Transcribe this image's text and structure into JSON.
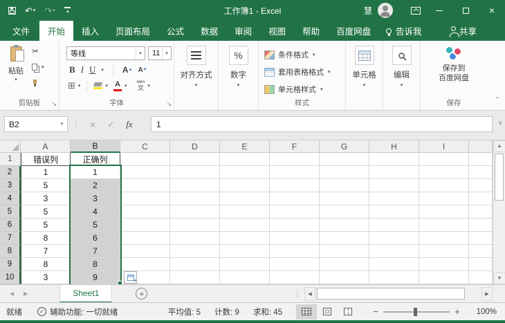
{
  "colors": {
    "excel_green": "#217346",
    "selection_fill": "#d2d2d2",
    "fill_color_swatch": "#ffe51f",
    "font_color_swatch": "#e00c0c",
    "baidu_teal": "#2fb8b4",
    "baidu_blue": "#3f87d6",
    "baidu_red": "#e14a68"
  },
  "glyphs": {
    "dropdown": "▾",
    "undo": "↶",
    "redo": "↷",
    "launcher": "↘",
    "expand": "˅",
    "collapse": "ˆ",
    "more_dots": "⋮",
    "scissors": "✂",
    "up": "▲",
    "down": "▼",
    "left": "◀",
    "right": "▶",
    "grow_caret": "▲",
    "shrink_caret": "▼",
    "close": "×",
    "percent": "%"
  },
  "titlebar": {
    "title": "工作簿1 - Excel",
    "user_name": "慧"
  },
  "tabs": {
    "items": [
      "文件",
      "开始",
      "插入",
      "页面布局",
      "公式",
      "数据",
      "审阅",
      "视图",
      "帮助",
      "百度网盘"
    ],
    "active": "开始",
    "tell_me": "告诉我",
    "share": "共享"
  },
  "ribbon": {
    "clipboard": {
      "paste_label": "粘贴",
      "group_label": "剪贴板"
    },
    "font": {
      "font_name": "等线",
      "font_size": "11",
      "bold": "B",
      "italic": "I",
      "underline": "U",
      "grow": "A",
      "shrink": "A",
      "phonetic_top": "wén",
      "phonetic_bottom": "文",
      "group_label": "字体"
    },
    "alignment": {
      "label": "对齐方式"
    },
    "number": {
      "label": "数字",
      "icon_text": "%"
    },
    "styles": {
      "items": [
        "条件格式",
        "套用表格格式",
        "单元格样式"
      ],
      "group_label": "样式"
    },
    "cells": {
      "label": "单元格"
    },
    "editing": {
      "label": "编辑"
    },
    "baidu_save": {
      "button_line1": "保存到",
      "button_line2": "百度网盘",
      "group_label": "保存"
    }
  },
  "formula_bar": {
    "name_box": "B2",
    "cancel": "×",
    "enter": "✓",
    "fx": "fx",
    "value": "1"
  },
  "grid": {
    "columns": [
      "A",
      "B",
      "C",
      "D",
      "E",
      "F",
      "G",
      "H",
      "I"
    ],
    "row_count": 10,
    "cells": {
      "A": [
        "错误列",
        "1",
        "5",
        "3",
        "5",
        "5",
        "8",
        "7",
        "8",
        "3"
      ],
      "B": [
        "正确列",
        "1",
        "2",
        "3",
        "4",
        "5",
        "6",
        "7",
        "8",
        "9"
      ]
    },
    "selection": {
      "column": "B",
      "row_start": 2,
      "row_end": 10,
      "active_cell": "B2"
    }
  },
  "sheet_bar": {
    "sheet_name": "Sheet1",
    "new_sheet": "+"
  },
  "status_bar": {
    "mode": "就绪",
    "accessibility": "辅助功能: 一切就绪",
    "average": "平均值: 5",
    "count": "计数: 9",
    "sum": "求和: 45",
    "zoom_out": "−",
    "zoom_in": "+",
    "zoom_level": "100%"
  }
}
